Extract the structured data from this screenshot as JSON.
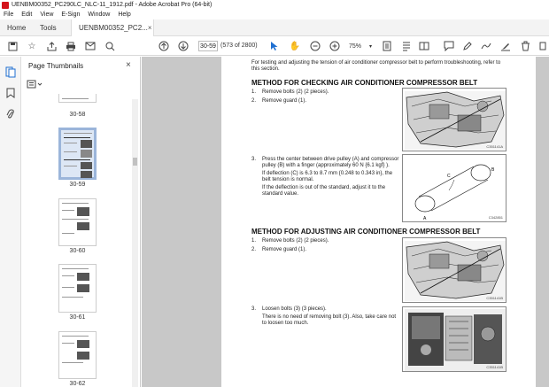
{
  "window": {
    "title": "UENBM00352_PC290LC_NLC-11_1912.pdf - Adobe Acrobat Pro (64-bit)"
  },
  "menu": [
    "File",
    "Edit",
    "View",
    "E-Sign",
    "Window",
    "Help"
  ],
  "tabs": {
    "home": "Home",
    "tools": "Tools",
    "document": "UENBM00352_PC2...",
    "close": "×"
  },
  "toolbar": {
    "page_current": "30-59",
    "page_total": "(573 of 2800)",
    "zoom": "75%"
  },
  "thumbnail_panel": {
    "title": "Page Thumbnails",
    "close": "×",
    "labels": [
      "30-58",
      "30-59",
      "30-60",
      "30-61",
      "30-62"
    ]
  },
  "document": {
    "intro": "For testing and adjusting the tension of air conditioner compressor belt to perform troubleshooting, refer to this section.",
    "section1": {
      "heading": "METHOD FOR CHECKING AIR CONDITIONER COMPRESSOR BELT",
      "steps": [
        {
          "num": "1.",
          "text": "Remove bolts (2) (2 pieces)."
        },
        {
          "num": "2.",
          "text": "Remove guard (1)."
        }
      ],
      "step3": {
        "num": "3.",
        "text": "Press the center between drive pulley (A) and compressor pulley (B) with a finger (approximately 60 N {6.1 kgf} ).",
        "p2": "If deflection (C) is 6.3 to 8.7 mm {0.248 to 0.343 in}, the belt tension is normal.",
        "p3": "If the deflection is out of the standard, adjust it to the standard value."
      },
      "fig1_code": "C351141A",
      "fig2_code": "C342851"
    },
    "section2": {
      "heading": "METHOD FOR ADJUSTING AIR CONDITIONER COMPRESSOR BELT",
      "steps": [
        {
          "num": "1.",
          "text": "Remove bolts (2) (2 pieces)."
        },
        {
          "num": "2.",
          "text": "Remove guard (1)."
        }
      ],
      "step3": {
        "num": "3.",
        "text": "Loosen bolts (3) (3 pieces).",
        "p2": "There is no need of removing bolt (3). Also, take care not to loosen too much."
      },
      "fig3_code": "C351141B",
      "fig4_code": "C351141B"
    }
  }
}
